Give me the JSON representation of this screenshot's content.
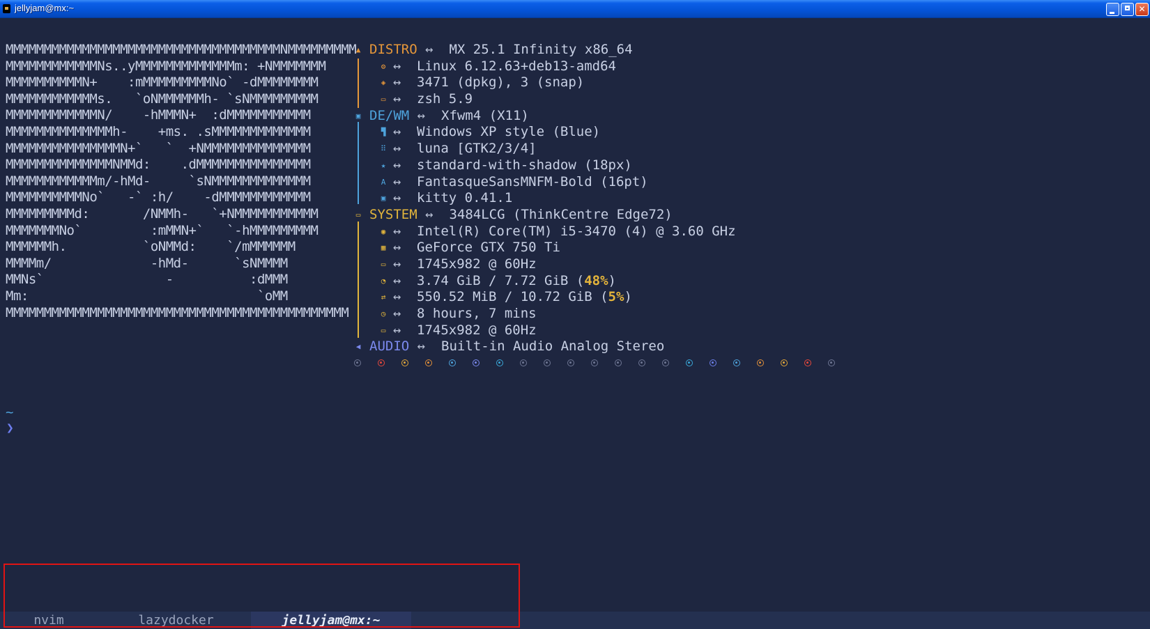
{
  "window": {
    "title": "jellyjam@mx:~"
  },
  "logo": [
    "MMMMMMMMMMMMMMMMMMMMMMMMMMMMMMMMMMMMNMMMMMMMMM",
    "MMMMMMMMMMMMNs..yMMMMMMMMMMMMMm: +NMMMMMMM",
    "MMMMMMMMMMN+    :mMMMMMMMMMNo` -dMMMMMMMM",
    "MMMMMMMMMMMMs.   `oNMMMMMMh- `sNMMMMMMMMM",
    "MMMMMMMMMMMMN/    -hMMMN+  :dMMMMMMMMMMM",
    "MMMMMMMMMMMMMMh-    +ms. .sMMMMMMMMMMMMM",
    "MMMMMMMMMMMMMMMN+`   `  +NMMMMMMMMMMMMMM",
    "MMMMMMMMMMMMMMNMMd:    .dMMMMMMMMMMMMMMM",
    "MMMMMMMMMMMMm/-hMd-     `sNMMMMMMMMMMMMM",
    "MMMMMMMMMMNo`   -` :h/    -dMMMMMMMMMMMM",
    "MMMMMMMMMd:       /NMMh-   `+NMMMMMMMMMMM",
    "MMMMMMMNo`         :mMMN+`   `-hMMMMMMMMM",
    "MMMMMMh.          `oNMMd:    `/mMMMMMM",
    "MMMMm/             -hMd-      `sNMMMM",
    "MMNs`                -          :dMMM",
    "Mm:                              `oMM",
    "MMMMMMMMMMMMMMMMMMMMMMMMMMMMMMMMMMMMMMMMMMMMM"
  ],
  "sections": {
    "distro": {
      "label": "DISTRO",
      "arrow": "↔",
      "value": "MX 25.1 Infinity x86_64",
      "items": [
        {
          "icon": "kernel-gear-icon",
          "value": "Linux 6.12.63+deb13-amd64"
        },
        {
          "icon": "package-icon",
          "value": "3471 (dpkg), 3 (snap)"
        },
        {
          "icon": "terminal-shell-icon",
          "value": "zsh 5.9"
        }
      ]
    },
    "dewm": {
      "label": "DE/WM",
      "arrow": "↔",
      "value": "Xfwm4 (X11)",
      "items": [
        {
          "icon": "paint-roller-icon",
          "value": "Windows XP style (Blue)"
        },
        {
          "icon": "icon-grid-icon",
          "value": "luna [GTK2/3/4]"
        },
        {
          "icon": "star-cursor-icon",
          "value": "standard-with-shadow (18px)"
        },
        {
          "icon": "font-icon",
          "value": "FantasqueSansMNFM-Bold (16pt)"
        },
        {
          "icon": "terminal-app-icon",
          "value": "kitty 0.41.1"
        }
      ]
    },
    "system": {
      "label": "SYSTEM",
      "arrow": "↔",
      "value": "3484LCG (ThinkCentre Edge72)",
      "items": [
        {
          "icon": "cpu-icon",
          "value": "Intel(R) Core(TM) i5-3470 (4) @ 3.60 GHz"
        },
        {
          "icon": "gpu-icon",
          "value": "GeForce GTX 750 Ti"
        },
        {
          "icon": "monitor-icon",
          "value": "1745x982 @ 60Hz"
        },
        {
          "icon": "memory-gauge-icon",
          "value": "3.74 GiB / 7.72 GiB (",
          "pct": "48%",
          "after": ")"
        },
        {
          "icon": "swap-icon",
          "value": "550.52 MiB / 10.72 GiB (",
          "pct": "5%",
          "after": ")"
        },
        {
          "icon": "clock-icon",
          "value": "8 hours, 7 mins"
        },
        {
          "icon": "monitor-icon",
          "value": "1745x982 @ 60Hz"
        }
      ]
    },
    "audio": {
      "label": "AUDIO",
      "arrow": "↔",
      "value": "Built-in Audio Analog Stereo"
    }
  },
  "colors": {
    "distro": "#e6973a",
    "dewm": "#4ea3dc",
    "system": "#e2b53c",
    "audio": "#7b89ed",
    "background": "#1e2640",
    "text": "#c8d0e4"
  },
  "dots": [
    "#6e7693",
    "#e5483c",
    "#e0a63a",
    "#e08f3a",
    "#4ea3dc",
    "#7b89ed",
    "#3aa8d8",
    "#6e7693",
    "#6e7693",
    "#6e7693",
    "#6e7693",
    "#6e7693",
    "#6e7693",
    "#6e7693",
    "#3aa8d8",
    "#6b7ee8",
    "#4ea3dc",
    "#e08f3a",
    "#e0a63a",
    "#e5483c",
    "#6e7693"
  ],
  "prompt": {
    "tilde": "~",
    "arrow": "❯"
  },
  "tabs": [
    {
      "label": "nvim",
      "active": false
    },
    {
      "label": "lazydocker",
      "active": false
    },
    {
      "label": "jellyjam@mx:~",
      "active": true
    }
  ]
}
